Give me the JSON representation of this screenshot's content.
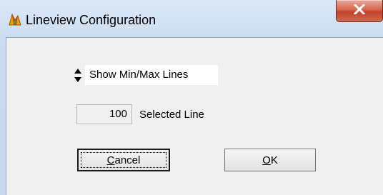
{
  "window": {
    "title": "Lineview Configuration",
    "close_label": "X"
  },
  "mode_select": {
    "value": "Show Min/Max Lines"
  },
  "line_field": {
    "value": "100",
    "label": "Selected Line"
  },
  "buttons": {
    "cancel_first": "C",
    "cancel_rest": "ancel",
    "ok_first": "O",
    "ok_rest": "K"
  },
  "icons": {
    "app": "app-icon",
    "close": "close-icon",
    "spin_up": "spin-up-arrow-icon",
    "spin_down": "spin-down-arrow-icon"
  }
}
